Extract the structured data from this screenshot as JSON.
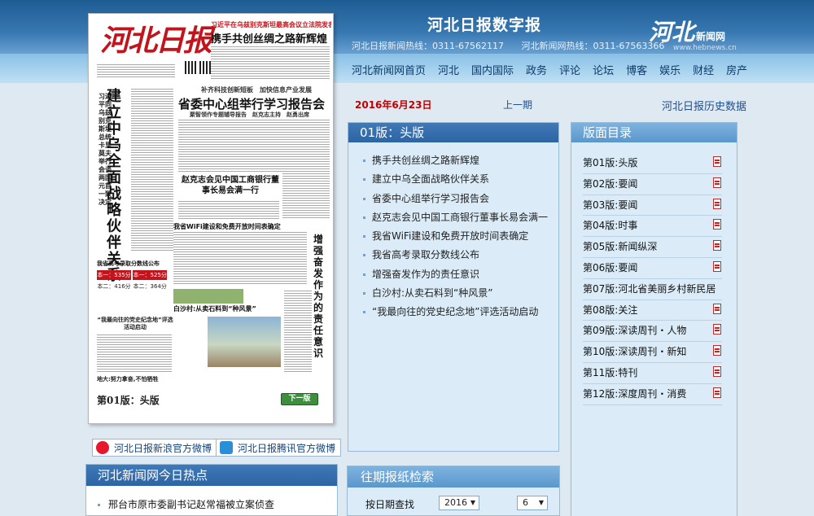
{
  "header": {
    "site_title": "河北日报数字报",
    "hotline1": "河北日报新闻热线：0311-67562117",
    "hotline2": "河北新闻网热线：0311-67563366",
    "logo_text": "河北",
    "logo_small": "新闻网",
    "logo_url": "www.hebnews.cn"
  },
  "nav": [
    "河北新闻网首页",
    "河北",
    "国内国际",
    "政务",
    "评论",
    "论坛",
    "博客",
    "娱乐",
    "财经",
    "房产"
  ],
  "newspaper": {
    "masthead": "河北日报",
    "top_subhead": "习近平在乌兹别克斯坦最高会议立法院发表重要演讲",
    "top_headline": "携手共创丝绸之路新辉煌",
    "vertical_small": "习近平同乌兹别克斯坦总统卡里莫夫举行会谈 两国元首一致决定",
    "vertical_headline": "建立中乌全面战略伙伴关系",
    "kicker": "补齐科技创新短板　加快信息产业发展",
    "headline1": "省委中心组举行学习报告会",
    "subhead1": "聚智领作专题辅导报告　赵克志主持　赵勇出席",
    "headline2": "赵克志会见中国工商银行董事长易会满一行",
    "headline3": "我省WiFi建设和免费开放时间表确定",
    "vertical_right": "增强奋发作为的责任意识",
    "score_title": "我省高考录取分数线公布",
    "score_cells": [
      "本一：535分",
      "本一：525分",
      "本二：416分",
      "本二：364分"
    ],
    "caption_village": "白沙村:从卖石料到“种风景”",
    "caption_memorial": "“我最向往的党史纪念地”评选活动启动",
    "caption_bottom": "地大:努力拿奋,不怕牺牲",
    "edition_label": "第01版：头版",
    "next_label": "下一版"
  },
  "weibo": {
    "sina": "河北日报新浪官方微博",
    "tencent": "河北日报腾讯官方微博"
  },
  "datebar": {
    "date": "2016年6月23日",
    "prev": "上一期",
    "history": "河北日报历史数据"
  },
  "articles_panel": {
    "title": "01版：头版",
    "items": [
      "携手共创丝绸之路新辉煌",
      "建立中乌全面战略伙伴关系",
      "省委中心组举行学习报告会",
      "赵克志会见中国工商银行董事长易会满一",
      "我省WiFi建设和免费开放时间表确定",
      "我省高考录取分数线公布",
      "增强奋发作为的责任意识",
      "白沙村:从卖石料到“种风景”",
      "“我最向往的党史纪念地”评选活动启动"
    ]
  },
  "sections_panel": {
    "title": "版面目录",
    "items": [
      {
        "label": "第01版:头版",
        "pdf": true
      },
      {
        "label": "第02版:要闻",
        "pdf": true
      },
      {
        "label": "第03版:要闻",
        "pdf": true
      },
      {
        "label": "第04版:时事",
        "pdf": true
      },
      {
        "label": "第05版:新闻纵深",
        "pdf": true
      },
      {
        "label": "第06版:要闻",
        "pdf": true
      },
      {
        "label": "第07版:河北省美丽乡村新民居",
        "pdf": false
      },
      {
        "label": "第08版:关注",
        "pdf": true
      },
      {
        "label": "第09版:深读周刊・人物",
        "pdf": true
      },
      {
        "label": "第10版:深读周刊・新知",
        "pdf": true
      },
      {
        "label": "第11版:特刊",
        "pdf": true
      },
      {
        "label": "第12版:深度周刊・消费",
        "pdf": true
      }
    ]
  },
  "hot_panel": {
    "title": "河北新闻网今日热点",
    "first_item": "邢台市原市委副书记赵常福被立案侦查"
  },
  "search_panel": {
    "title": "往期报纸检索",
    "label": "按日期查找",
    "year": "2016",
    "month": "6"
  },
  "colors": {
    "accent_red": "#c00000",
    "panel_blue": "#2d64a3",
    "link_blue": "#1f4f8f"
  }
}
